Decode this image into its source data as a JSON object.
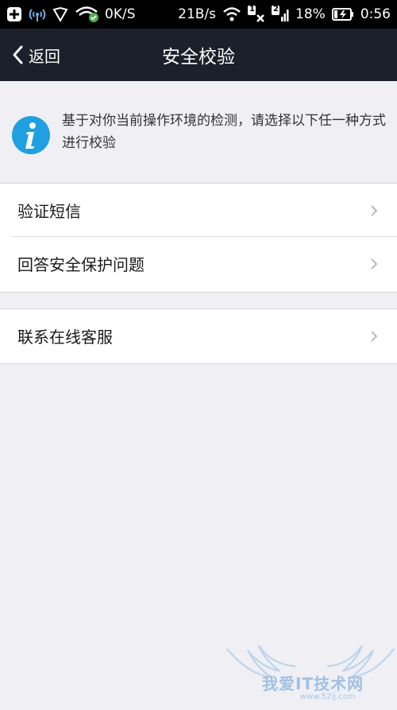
{
  "status_bar": {
    "speed_left": "0K/S",
    "speed_mid": "21B/s",
    "sim1": "1",
    "sim2": "2",
    "battery": "18%",
    "time": "0:56"
  },
  "nav": {
    "back_label": "返回",
    "title": "安全校验"
  },
  "info": {
    "text": "基于对你当前操作环境的检测，请选择以下任一种方式进行校验",
    "icon": "info-icon",
    "icon_color": "#1fa0e0"
  },
  "options": {
    "group1": [
      {
        "label": "验证短信"
      },
      {
        "label": "回答安全保护问题"
      }
    ],
    "group2": [
      {
        "label": "联系在线客服"
      }
    ]
  },
  "watermark": {
    "text": "我爱IT技术网",
    "url": "www.52ij.com"
  }
}
